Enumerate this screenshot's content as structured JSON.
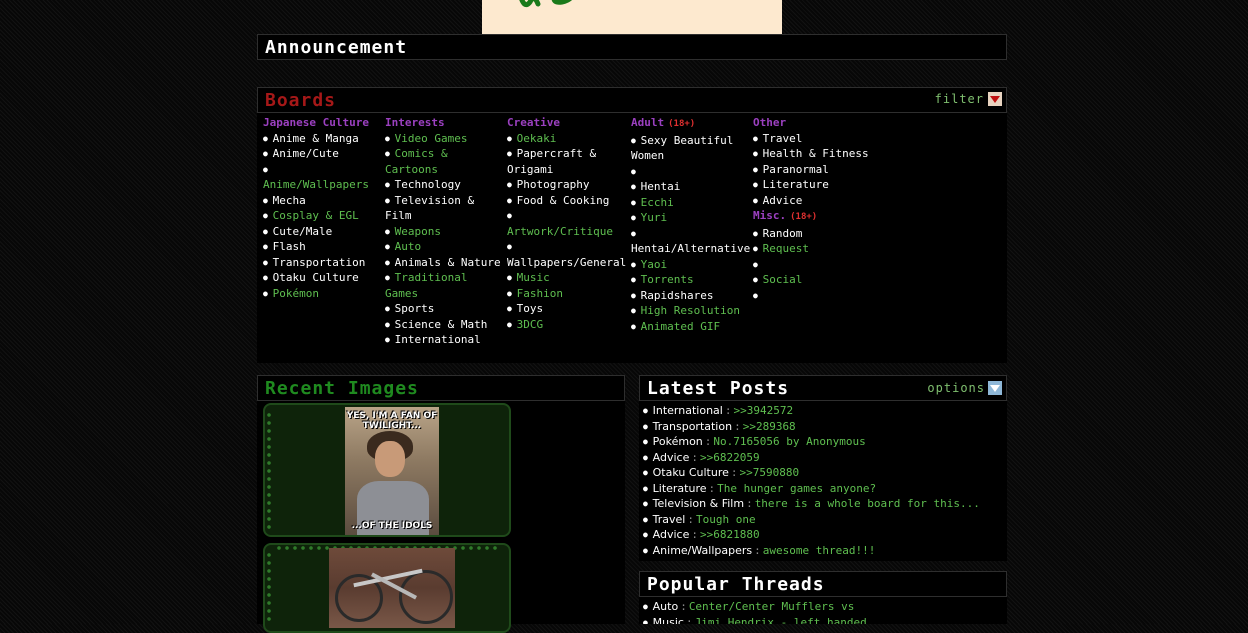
{
  "announcement": {
    "title": "Announcement"
  },
  "boards": {
    "title": "Boards",
    "filter_label": "filter",
    "columns": [
      {
        "heading": "Japanese Culture",
        "age": "",
        "groups": [
          {
            "items": [
              {
                "label": "Anime & Manga",
                "color": "white"
              },
              {
                "label": "Anime/Cute",
                "color": "white"
              },
              {
                "label": "",
                "color": "white"
              },
              {
                "label": "Anime/Wallpapers",
                "color": "green",
                "nobullet": true
              },
              {
                "label": "Mecha",
                "color": "white"
              },
              {
                "label": "Cosplay & EGL",
                "color": "green"
              },
              {
                "label": "Cute/Male",
                "color": "white"
              },
              {
                "label": "Flash",
                "color": "white"
              },
              {
                "label": "Transportation",
                "color": "white"
              },
              {
                "label": "Otaku Culture",
                "color": "white"
              },
              {
                "label": "Pokémon",
                "color": "green"
              }
            ]
          }
        ]
      },
      {
        "heading": "Interests",
        "age": "",
        "groups": [
          {
            "items": [
              {
                "label": "Video Games",
                "color": "green"
              },
              {
                "label": "Comics & Cartoons",
                "color": "green"
              },
              {
                "label": "Technology",
                "color": "white"
              },
              {
                "label": "Television & Film",
                "color": "white"
              },
              {
                "label": "Weapons",
                "color": "green"
              },
              {
                "label": "Auto",
                "color": "green"
              },
              {
                "label": "Animals & Nature",
                "color": "white"
              },
              {
                "label": "Traditional Games",
                "color": "green"
              },
              {
                "label": "Sports",
                "color": "white"
              },
              {
                "label": "Science & Math",
                "color": "white"
              },
              {
                "label": "International",
                "color": "white"
              }
            ]
          }
        ]
      },
      {
        "heading": "Creative",
        "age": "",
        "groups": [
          {
            "items": [
              {
                "label": "Oekaki",
                "color": "green"
              },
              {
                "label": "Papercraft & Origami",
                "color": "white"
              },
              {
                "label": "Photography",
                "color": "white"
              },
              {
                "label": "Food & Cooking",
                "color": "white"
              },
              {
                "label": "",
                "color": "white"
              },
              {
                "label": "Artwork/Critique",
                "color": "green",
                "nobullet": true
              },
              {
                "label": "",
                "color": "white"
              },
              {
                "label": "Wallpapers/General",
                "color": "white",
                "nobullet": true
              },
              {
                "label": "Music",
                "color": "green"
              },
              {
                "label": "Fashion",
                "color": "green"
              },
              {
                "label": "Toys",
                "color": "white"
              },
              {
                "label": "3DCG",
                "color": "green"
              }
            ]
          }
        ]
      },
      {
        "heading": "Adult",
        "age": "(18+)",
        "groups": [
          {
            "items": [
              {
                "label": "Sexy Beautiful Women",
                "color": "white"
              },
              {
                "label": "",
                "color": "white"
              },
              {
                "label": "Hentai",
                "color": "white"
              },
              {
                "label": "Ecchi",
                "color": "green"
              },
              {
                "label": "Yuri",
                "color": "green"
              },
              {
                "label": "",
                "color": "white"
              },
              {
                "label": "Hentai/Alternative",
                "color": "white",
                "nobullet": true
              },
              {
                "label": "Yaoi",
                "color": "green"
              },
              {
                "label": "Torrents",
                "color": "green"
              },
              {
                "label": "Rapidshares",
                "color": "white"
              },
              {
                "label": "High Resolution",
                "color": "green"
              },
              {
                "label": "Animated GIF",
                "color": "green"
              }
            ]
          }
        ]
      },
      {
        "heading": "Other",
        "age": "",
        "groups": [
          {
            "items": [
              {
                "label": "Travel",
                "color": "white"
              },
              {
                "label": "Health & Fitness",
                "color": "white"
              },
              {
                "label": "Paranormal",
                "color": "white"
              },
              {
                "label": "Literature",
                "color": "white"
              },
              {
                "label": "Advice",
                "color": "white"
              }
            ]
          },
          {
            "heading": "Misc.",
            "age": "(18+)",
            "items": [
              {
                "label": "Random",
                "color": "white"
              },
              {
                "label": "Request",
                "color": "green"
              },
              {
                "label": "",
                "color": "white"
              },
              {
                "label": "Social",
                "color": "green"
              },
              {
                "label": "",
                "color": "white"
              }
            ]
          }
        ]
      }
    ]
  },
  "recent_images": {
    "title": "Recent Images",
    "images": [
      {
        "caption_top": "YES, I'M A FAN OF TWILIGHT...",
        "caption_bottom": "...OF THE IDOLS"
      },
      {
        "caption_top": "",
        "caption_bottom": ""
      }
    ]
  },
  "latest_posts": {
    "title": "Latest Posts",
    "options_label": "options",
    "posts": [
      {
        "board": "International",
        "text": ">>3942572"
      },
      {
        "board": "Transportation",
        "text": ">>289368"
      },
      {
        "board": "Pokémon",
        "text": "No.7165056 by Anonymous"
      },
      {
        "board": "Advice",
        "text": ">>6822059"
      },
      {
        "board": "Otaku Culture",
        "text": ">>7590880"
      },
      {
        "board": "Literature",
        "text": "The hunger games anyone?"
      },
      {
        "board": "Television & Film",
        "text": "there is a whole board for this..."
      },
      {
        "board": "Travel",
        "text": "Tough one"
      },
      {
        "board": "Advice",
        "text": ">>6821880"
      },
      {
        "board": "Anime/Wallpapers",
        "text": "awesome thread!!!"
      }
    ]
  },
  "popular_threads": {
    "title": "Popular Threads",
    "threads": [
      {
        "board": "Auto",
        "text": "Center/Center Mufflers vs"
      },
      {
        "board": "Music",
        "text": "Jimi Hendrix - left handed"
      }
    ]
  },
  "colors": {
    "heading_purple": "#9b40c0",
    "boards_red": "#a61818",
    "link_green": "#5fbf50",
    "recent_green": "#1f8a1f"
  }
}
